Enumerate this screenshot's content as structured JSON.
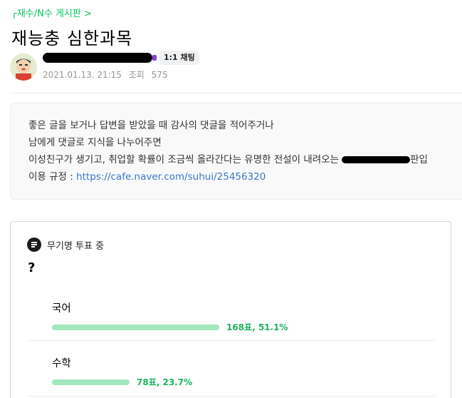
{
  "breadcrumb": "┌재수/N수 게시판 >",
  "title": "재능충 심한과목",
  "author": {
    "chat_button": "1:1 채팅",
    "date": "2021.01.13. 21:15",
    "views_label": "조회",
    "views": "575"
  },
  "notice": {
    "line1": "좋은 글을 보거나 답변을 받았을 때 감사의 댓글을 적어주거나",
    "line2": "남에게 댓글로 지식을 나누어주면",
    "line3": "이성친구가 생기고, 취업할 확률이 조금씩 올라간다는 유명한 전설이 내려오는",
    "line3_tail": "판입",
    "rules_label": "이용 규정 :",
    "rules_link": "https://cafe.naver.com/suhui/25456320"
  },
  "vote": {
    "label": "무기명 투표 중",
    "question": "?",
    "options": [
      {
        "label": "국어",
        "result": "168표, 51.1%",
        "percent": 51.1
      },
      {
        "label": "수학",
        "result": "78표, 23.7%",
        "percent": 23.7
      }
    ]
  },
  "colors": {
    "accent": "#03c75a",
    "bar": "#a3e7bd",
    "result_text": "#1bb35d",
    "link": "#3a77c8"
  }
}
